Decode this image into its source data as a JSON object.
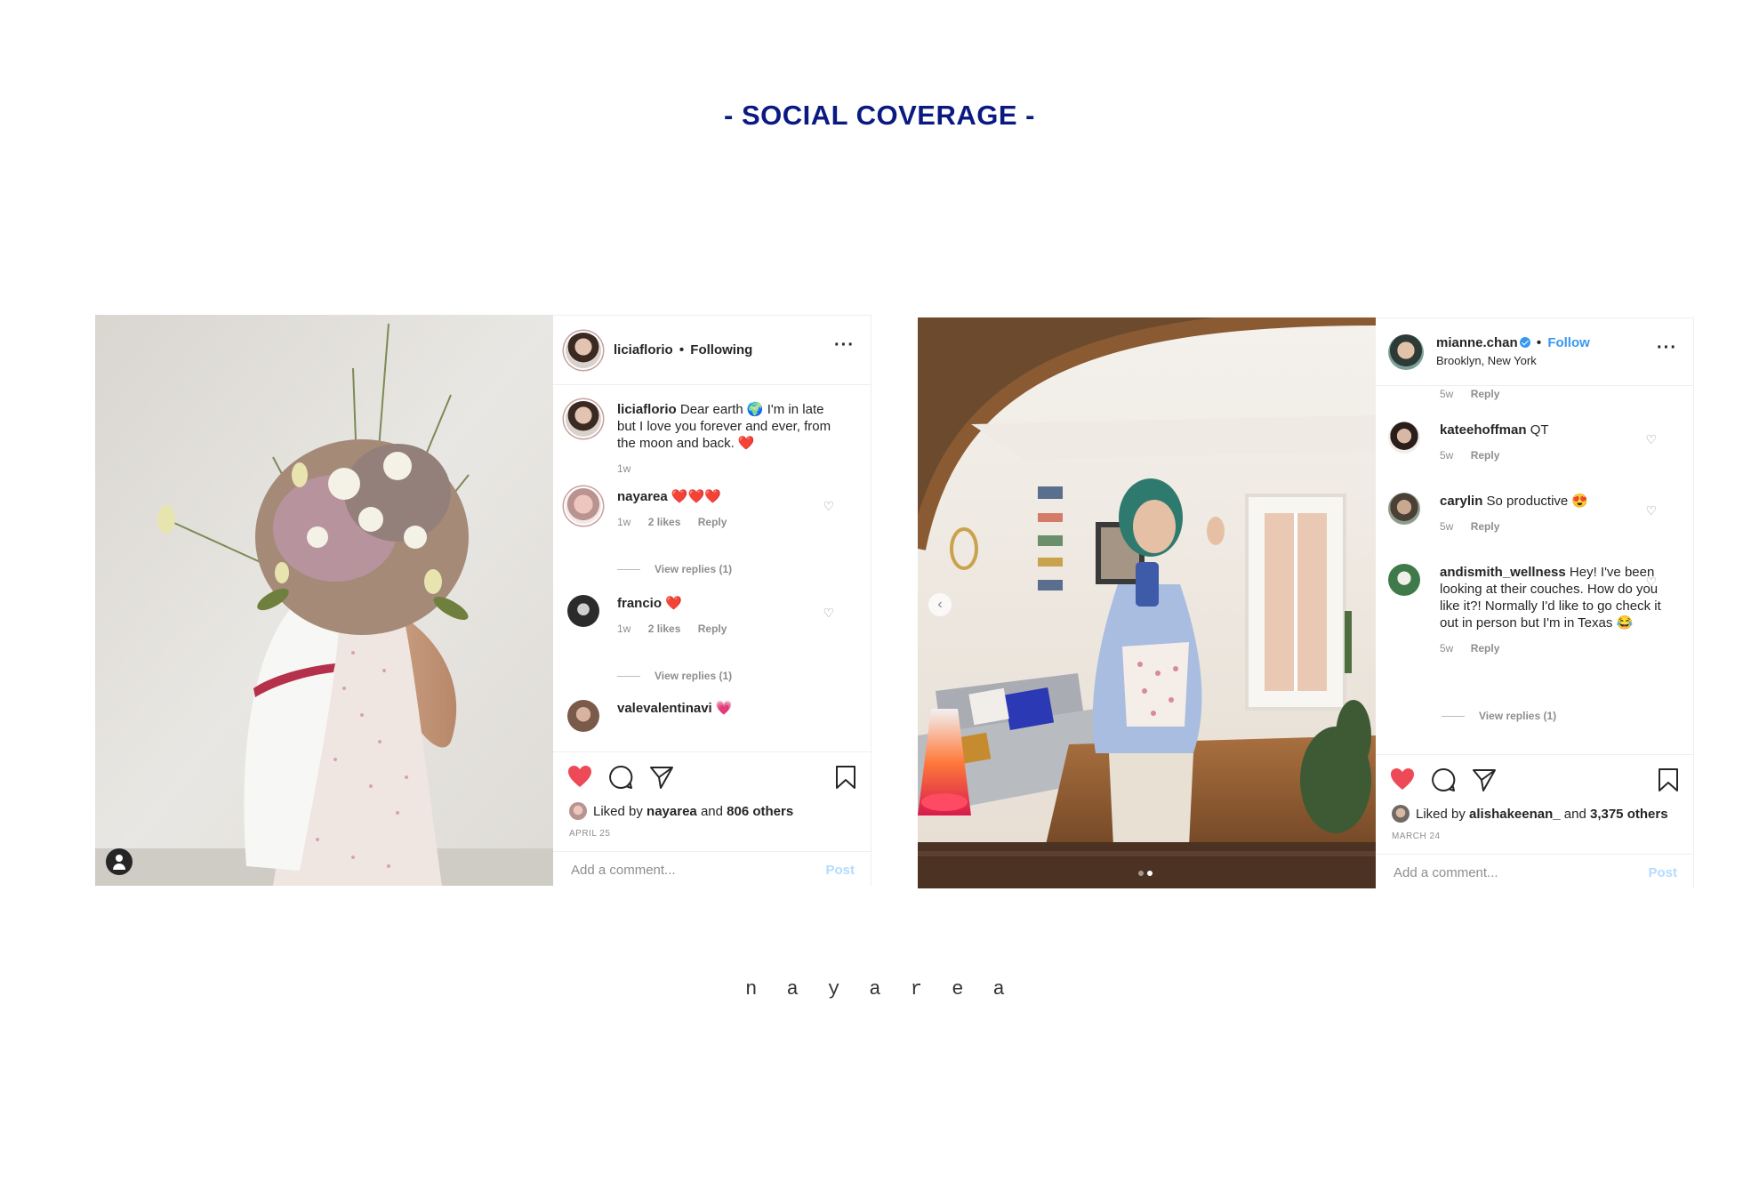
{
  "page": {
    "title": "- SOCIAL COVERAGE -",
    "footer_logo": "n a y a   r e a"
  },
  "post1": {
    "username": "liciaflorio",
    "separator": "•",
    "follow_status": "Following",
    "more": "···",
    "comments": [
      {
        "user": "liciaflorio",
        "text": "Dear earth 🌍 I'm in late but I love you forever and ever, from the moon and back. ❤️",
        "time": "1w"
      },
      {
        "user": "nayarea",
        "text": "❤️❤️❤️",
        "time": "1w",
        "likes": "2 likes",
        "reply": "Reply",
        "view_replies": "View replies (1)"
      },
      {
        "user": "francio",
        "text": "❤️",
        "time": "1w",
        "likes": "2 likes",
        "reply": "Reply",
        "view_replies": "View replies (1)"
      },
      {
        "user": "valevalentinavi",
        "text": "💗"
      }
    ],
    "liked_prefix": "Liked by",
    "liked_user": "nayarea",
    "liked_and": "and",
    "liked_others": "806 others",
    "date": "APRIL 25",
    "add_comment_placeholder": "Add a comment...",
    "post_button": "Post"
  },
  "post2": {
    "username": "mianne.chan",
    "separator": "•",
    "follow_status": "Follow",
    "location": "Brooklyn, New York",
    "more": "···",
    "top_meta": {
      "time": "5w",
      "reply": "Reply"
    },
    "comments": [
      {
        "user": "kateehoffman",
        "text": "QT",
        "time": "5w",
        "reply": "Reply"
      },
      {
        "user": "carylin",
        "text": "So productive 😍",
        "time": "5w",
        "reply": "Reply"
      },
      {
        "user": "andismith_wellness",
        "text": "Hey! I've been looking at their couches. How do you like it?! Normally I'd like to go check it out in person but I'm in Texas 😂",
        "time": "5w",
        "reply": "Reply",
        "view_replies": "View replies (1)"
      }
    ],
    "liked_prefix": "Liked by",
    "liked_user": "alishakeenan_",
    "liked_and": "and",
    "liked_others": "3,375 others",
    "date": "MARCH 24",
    "add_comment_placeholder": "Add a comment...",
    "post_button": "Post",
    "carousel_prev": "‹"
  },
  "colors": {
    "title_navy": "#0b1a82",
    "heart_red": "#ed4956",
    "link_blue": "#3897f0",
    "muted_gray": "#8e8e8e"
  }
}
